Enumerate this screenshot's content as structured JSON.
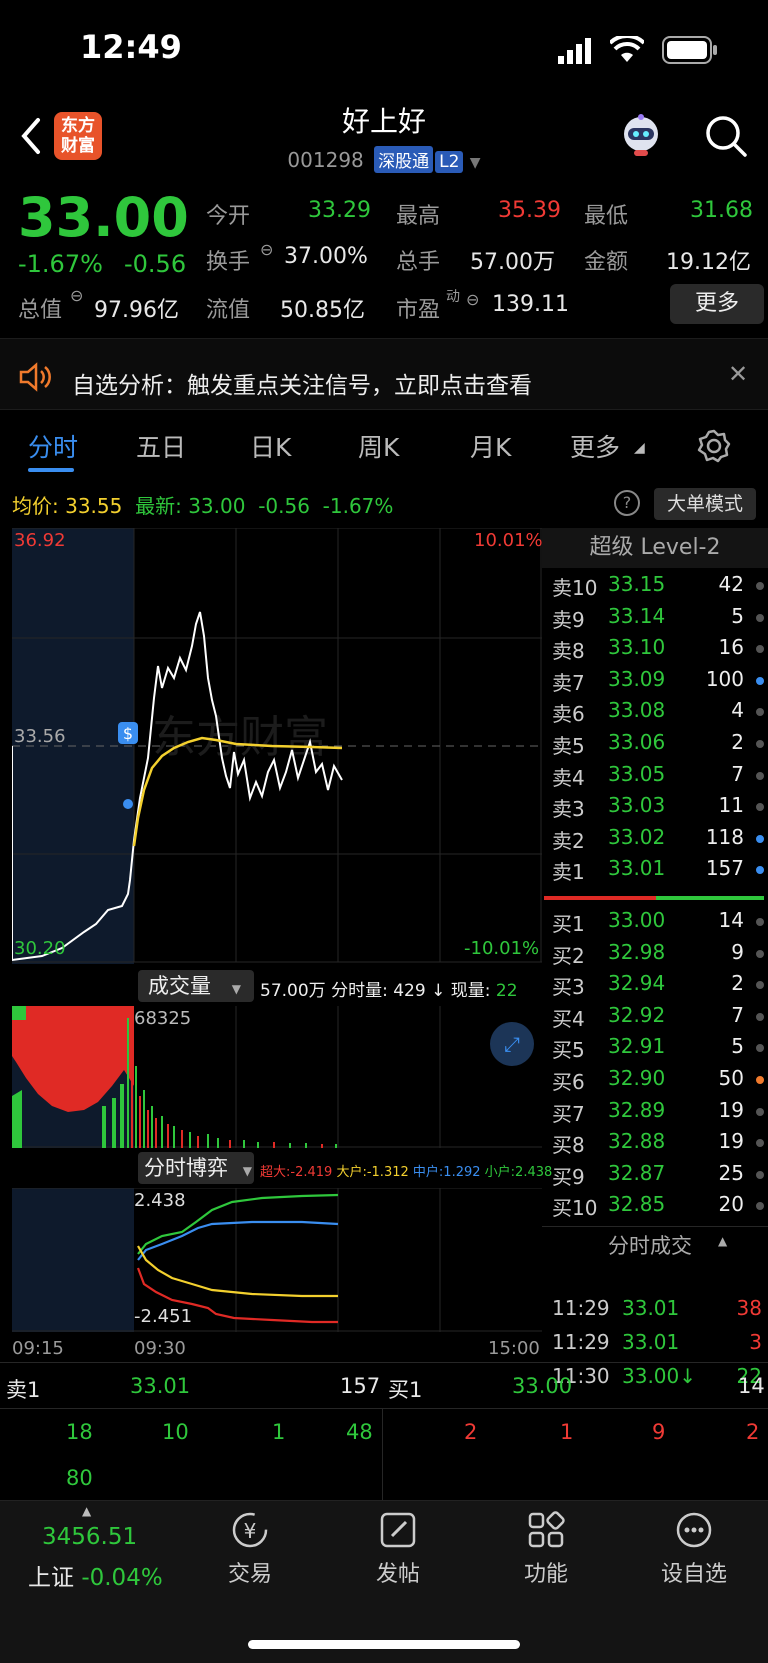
{
  "status": {
    "time": "12:49"
  },
  "header": {
    "title": "好上好",
    "code": "001298",
    "tag_connect": "深股通",
    "tag_level": "L2",
    "logo_line1": "东方",
    "logo_line2": "财富"
  },
  "quote": {
    "price": "33.00",
    "change_pct": "-1.67%",
    "change": "-0.56",
    "open_label": "今开",
    "open": "33.29",
    "high_label": "最高",
    "high": "35.39",
    "low_label": "最低",
    "low": "31.68",
    "turnover_label": "换手",
    "turnover": "37.00%",
    "volume_label": "总手",
    "volume": "57.00万",
    "amount_label": "金额",
    "amount": "19.12亿",
    "mktcap_label": "总值",
    "mktcap": "97.96亿",
    "float_label": "流值",
    "float": "50.85亿",
    "pe_label": "市盈",
    "pe_sup": "动",
    "pe": "139.11",
    "more_label": "更多"
  },
  "notice": {
    "text": "自选分析：触发重点关注信号，立即点击查看"
  },
  "tabs": [
    "分时",
    "五日",
    "日K",
    "周K",
    "月K",
    "更多"
  ],
  "infobar": {
    "avg_label": "均价:",
    "avg": "33.55",
    "latest_label": "最新:",
    "latest": "33.00",
    "latest_chg": "-0.56",
    "latest_pct": "-1.67%",
    "mode_label": "大单模式"
  },
  "chart": {
    "y_top": "36.92",
    "y_mid": "33.56",
    "y_bot": "30.20",
    "pct_top": "10.01%",
    "pct_bot": "-10.01%",
    "watermark": "东方财富"
  },
  "volume": {
    "selector": "成交量",
    "total": "57.00万",
    "min_label": "分时量:",
    "min_vol": "429 ↓",
    "cur_label": "现量:",
    "cur_vol": "22",
    "max": "68325"
  },
  "game": {
    "selector": "分时博弈",
    "super_label": "超大:",
    "super": "-2.419",
    "big_label": "大户:",
    "big": "-1.312",
    "mid_label": "中户:",
    "mid": "1.292",
    "small_label": "小户:",
    "small": "2.438",
    "y_top": "2.438",
    "y_bot": "-2.451"
  },
  "xaxis": {
    "t1": "09:15",
    "t2": "09:30",
    "t3": "15:00"
  },
  "orderbook": {
    "title": "超级 Level-2",
    "asks": [
      {
        "label": "卖10",
        "price": "33.15",
        "vol": "42"
      },
      {
        "label": "卖9",
        "price": "33.14",
        "vol": "5"
      },
      {
        "label": "卖8",
        "price": "33.10",
        "vol": "16"
      },
      {
        "label": "卖7",
        "price": "33.09",
        "vol": "100"
      },
      {
        "label": "卖6",
        "price": "33.08",
        "vol": "4"
      },
      {
        "label": "卖5",
        "price": "33.06",
        "vol": "2"
      },
      {
        "label": "卖4",
        "price": "33.05",
        "vol": "7"
      },
      {
        "label": "卖3",
        "price": "33.03",
        "vol": "11"
      },
      {
        "label": "卖2",
        "price": "33.02",
        "vol": "118"
      },
      {
        "label": "卖1",
        "price": "33.01",
        "vol": "157"
      }
    ],
    "bids": [
      {
        "label": "买1",
        "price": "33.00",
        "vol": "14"
      },
      {
        "label": "买2",
        "price": "32.98",
        "vol": "9"
      },
      {
        "label": "买3",
        "price": "32.94",
        "vol": "2"
      },
      {
        "label": "买4",
        "price": "32.92",
        "vol": "7"
      },
      {
        "label": "买5",
        "price": "32.91",
        "vol": "5"
      },
      {
        "label": "买6",
        "price": "32.90",
        "vol": "50"
      },
      {
        "label": "买7",
        "price": "32.89",
        "vol": "19"
      },
      {
        "label": "买8",
        "price": "32.88",
        "vol": "19"
      },
      {
        "label": "买9",
        "price": "32.87",
        "vol": "25"
      },
      {
        "label": "买10",
        "price": "32.85",
        "vol": "20"
      }
    ],
    "trades_title": "分时成交",
    "trades": [
      {
        "time": "11:29",
        "price": "33.01",
        "vol": "38"
      },
      {
        "time": "11:29",
        "price": "33.01",
        "vol": "3"
      },
      {
        "time": "11:30",
        "price": "33.00↓",
        "vol": "22"
      }
    ]
  },
  "bottom_book": {
    "sell_label": "卖1",
    "sell_price": "33.01",
    "sell_vol": "157",
    "buy_label": "买1",
    "buy_price": "33.00",
    "buy_vol": "14",
    "sell_queue": [
      "18",
      "10",
      "1",
      "48",
      "80"
    ],
    "buy_queue": [
      "2",
      "1",
      "9",
      "2"
    ]
  },
  "bottom_nav": {
    "index_value": "3456.51",
    "index_name": "上证",
    "index_chg": "-0.04%",
    "items": [
      "交易",
      "发帖",
      "功能",
      "设自选"
    ]
  }
}
